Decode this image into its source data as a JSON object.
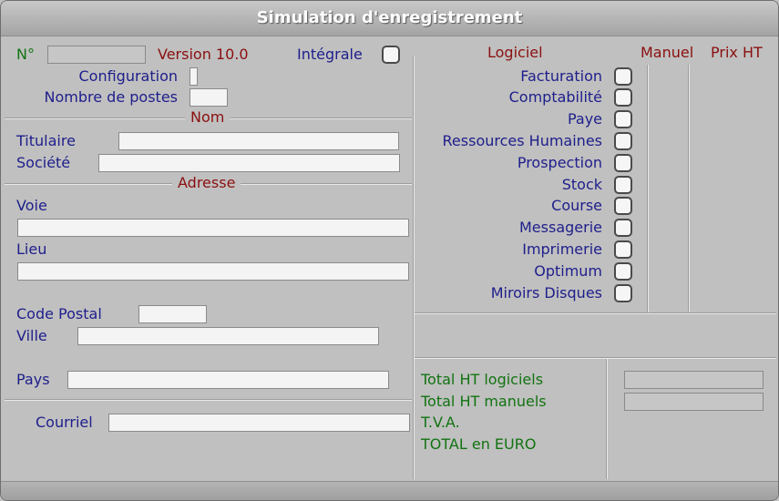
{
  "window": {
    "title": "Simulation d'enregistrement"
  },
  "header": {
    "num_label": "N°",
    "num_value": "",
    "version": "Version 10.0",
    "integrale_label": "Intégrale",
    "configuration_label": "Configuration",
    "configuration_value": "",
    "postes_label": "Nombre de postes",
    "postes_value": ""
  },
  "nom_section": {
    "title": "Nom",
    "titulaire_label": "Titulaire",
    "titulaire_value": "",
    "societe_label": "Société",
    "societe_value": ""
  },
  "adresse_section": {
    "title": "Adresse",
    "voie_label": "Voie",
    "voie_value": "",
    "lieu_label": "Lieu",
    "lieu_value": "",
    "cp_label": "Code Postal",
    "cp_value": "",
    "ville_label": "Ville",
    "ville_value": "",
    "pays_label": "Pays",
    "pays_value": ""
  },
  "courriel": {
    "label": "Courriel",
    "value": ""
  },
  "logiciels": {
    "header_logiciel": "Logiciel",
    "header_manuel": "Manuel",
    "header_prix": "Prix HT",
    "items": [
      {
        "label": "Facturation"
      },
      {
        "label": "Comptabilité"
      },
      {
        "label": "Paye"
      },
      {
        "label": "Ressources Humaines"
      },
      {
        "label": "Prospection"
      },
      {
        "label": "Stock"
      },
      {
        "label": "Course"
      },
      {
        "label": "Messagerie"
      },
      {
        "label": "Imprimerie"
      },
      {
        "label": "Optimum"
      },
      {
        "label": "Miroirs Disques"
      }
    ]
  },
  "totals": {
    "ht_logiciels_label": "Total HT logiciels",
    "ht_logiciels_value": "",
    "ht_manuels_label": "Total HT manuels",
    "ht_manuels_value": "",
    "tva_label": "T.V.A.",
    "total_label": "TOTAL en EURO"
  }
}
